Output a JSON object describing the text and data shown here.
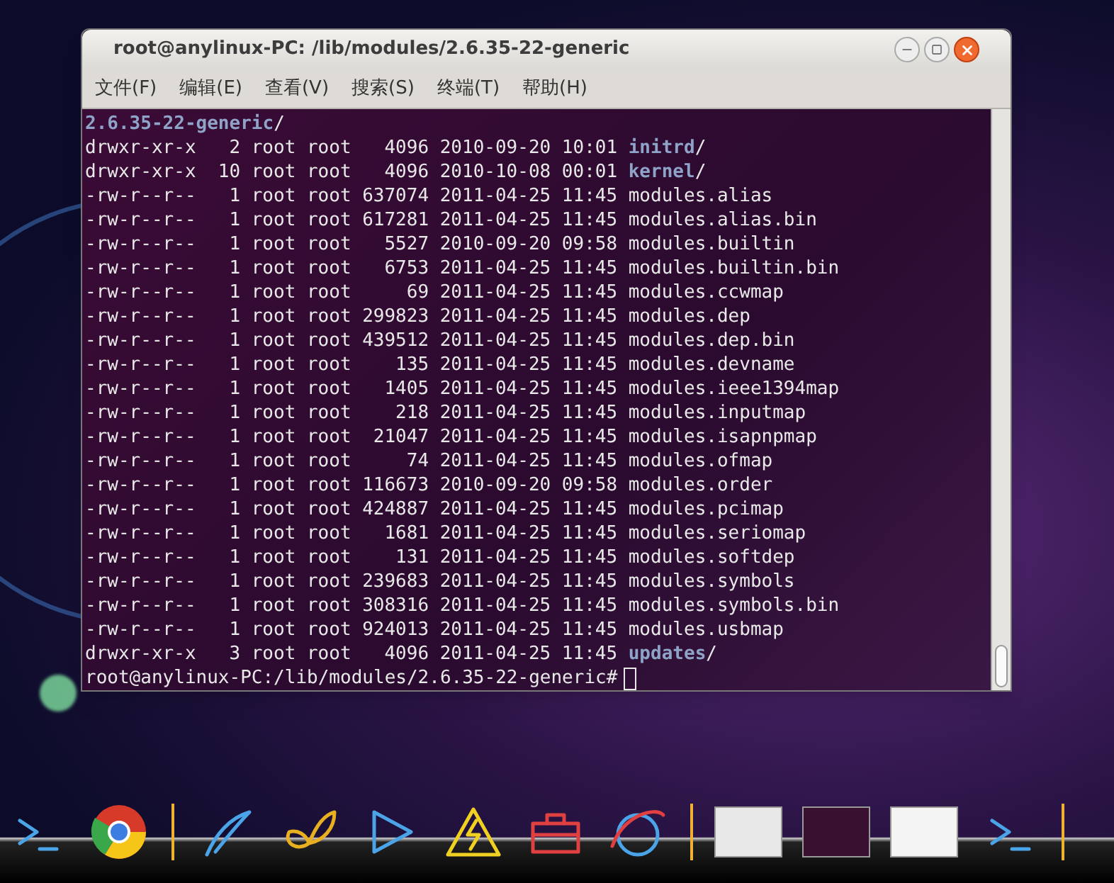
{
  "window": {
    "title": "root@anylinux-PC: /lib/modules/2.6.35-22-generic"
  },
  "menu": [
    {
      "label": "文件(F)"
    },
    {
      "label": "编辑(E)"
    },
    {
      "label": "查看(V)"
    },
    {
      "label": "搜索(S)"
    },
    {
      "label": "终端(T)"
    },
    {
      "label": "帮助(H)"
    }
  ],
  "terminal": {
    "header": "2.6.35-22-generic",
    "header_suffix": "/",
    "rows": [
      {
        "kind": "dir",
        "perms": "drwxr-xr-x",
        "links": "2",
        "owner": "root",
        "group": "root",
        "size": "4096",
        "date": "2010-09-20",
        "time": "10:01",
        "name": "initrd",
        "suffix": "/"
      },
      {
        "kind": "dir",
        "perms": "drwxr-xr-x",
        "links": "10",
        "owner": "root",
        "group": "root",
        "size": "4096",
        "date": "2010-10-08",
        "time": "00:01",
        "name": "kernel",
        "suffix": "/"
      },
      {
        "kind": "file",
        "perms": "-rw-r--r--",
        "links": "1",
        "owner": "root",
        "group": "root",
        "size": "637074",
        "date": "2011-04-25",
        "time": "11:45",
        "name": "modules.alias"
      },
      {
        "kind": "file",
        "perms": "-rw-r--r--",
        "links": "1",
        "owner": "root",
        "group": "root",
        "size": "617281",
        "date": "2011-04-25",
        "time": "11:45",
        "name": "modules.alias.bin"
      },
      {
        "kind": "file",
        "perms": "-rw-r--r--",
        "links": "1",
        "owner": "root",
        "group": "root",
        "size": "5527",
        "date": "2010-09-20",
        "time": "09:58",
        "name": "modules.builtin"
      },
      {
        "kind": "file",
        "perms": "-rw-r--r--",
        "links": "1",
        "owner": "root",
        "group": "root",
        "size": "6753",
        "date": "2011-04-25",
        "time": "11:45",
        "name": "modules.builtin.bin"
      },
      {
        "kind": "file",
        "perms": "-rw-r--r--",
        "links": "1",
        "owner": "root",
        "group": "root",
        "size": "69",
        "date": "2011-04-25",
        "time": "11:45",
        "name": "modules.ccwmap"
      },
      {
        "kind": "file",
        "perms": "-rw-r--r--",
        "links": "1",
        "owner": "root",
        "group": "root",
        "size": "299823",
        "date": "2011-04-25",
        "time": "11:45",
        "name": "modules.dep"
      },
      {
        "kind": "file",
        "perms": "-rw-r--r--",
        "links": "1",
        "owner": "root",
        "group": "root",
        "size": "439512",
        "date": "2011-04-25",
        "time": "11:45",
        "name": "modules.dep.bin"
      },
      {
        "kind": "file",
        "perms": "-rw-r--r--",
        "links": "1",
        "owner": "root",
        "group": "root",
        "size": "135",
        "date": "2011-04-25",
        "time": "11:45",
        "name": "modules.devname"
      },
      {
        "kind": "file",
        "perms": "-rw-r--r--",
        "links": "1",
        "owner": "root",
        "group": "root",
        "size": "1405",
        "date": "2011-04-25",
        "time": "11:45",
        "name": "modules.ieee1394map"
      },
      {
        "kind": "file",
        "perms": "-rw-r--r--",
        "links": "1",
        "owner": "root",
        "group": "root",
        "size": "218",
        "date": "2011-04-25",
        "time": "11:45",
        "name": "modules.inputmap"
      },
      {
        "kind": "file",
        "perms": "-rw-r--r--",
        "links": "1",
        "owner": "root",
        "group": "root",
        "size": "21047",
        "date": "2011-04-25",
        "time": "11:45",
        "name": "modules.isapnpmap"
      },
      {
        "kind": "file",
        "perms": "-rw-r--r--",
        "links": "1",
        "owner": "root",
        "group": "root",
        "size": "74",
        "date": "2011-04-25",
        "time": "11:45",
        "name": "modules.ofmap"
      },
      {
        "kind": "file",
        "perms": "-rw-r--r--",
        "links": "1",
        "owner": "root",
        "group": "root",
        "size": "116673",
        "date": "2010-09-20",
        "time": "09:58",
        "name": "modules.order"
      },
      {
        "kind": "file",
        "perms": "-rw-r--r--",
        "links": "1",
        "owner": "root",
        "group": "root",
        "size": "424887",
        "date": "2011-04-25",
        "time": "11:45",
        "name": "modules.pcimap"
      },
      {
        "kind": "file",
        "perms": "-rw-r--r--",
        "links": "1",
        "owner": "root",
        "group": "root",
        "size": "1681",
        "date": "2011-04-25",
        "time": "11:45",
        "name": "modules.seriomap"
      },
      {
        "kind": "file",
        "perms": "-rw-r--r--",
        "links": "1",
        "owner": "root",
        "group": "root",
        "size": "131",
        "date": "2011-04-25",
        "time": "11:45",
        "name": "modules.softdep"
      },
      {
        "kind": "file",
        "perms": "-rw-r--r--",
        "links": "1",
        "owner": "root",
        "group": "root",
        "size": "239683",
        "date": "2011-04-25",
        "time": "11:45",
        "name": "modules.symbols"
      },
      {
        "kind": "file",
        "perms": "-rw-r--r--",
        "links": "1",
        "owner": "root",
        "group": "root",
        "size": "308316",
        "date": "2011-04-25",
        "time": "11:45",
        "name": "modules.symbols.bin"
      },
      {
        "kind": "file",
        "perms": "-rw-r--r--",
        "links": "1",
        "owner": "root",
        "group": "root",
        "size": "924013",
        "date": "2011-04-25",
        "time": "11:45",
        "name": "modules.usbmap"
      },
      {
        "kind": "dir",
        "perms": "drwxr-xr-x",
        "links": "3",
        "owner": "root",
        "group": "root",
        "size": "4096",
        "date": "2011-04-25",
        "time": "11:45",
        "name": "updates",
        "suffix": "/"
      }
    ],
    "prompt": "root@anylinux-PC:/lib/modules/2.6.35-22-generic#"
  }
}
